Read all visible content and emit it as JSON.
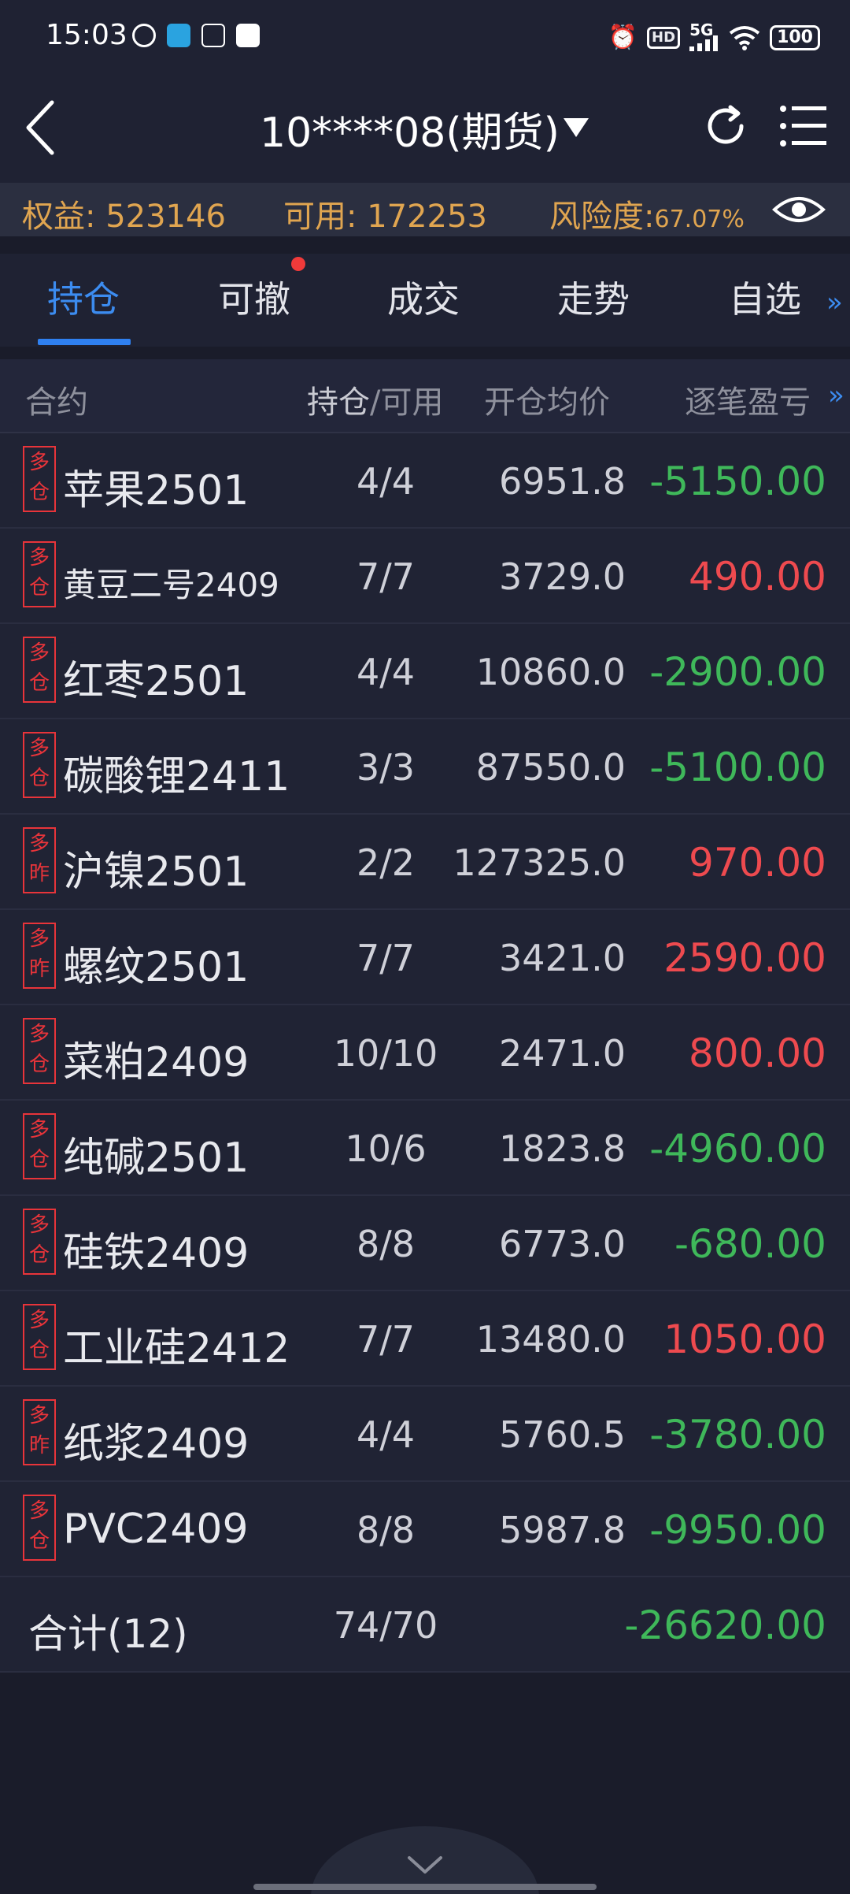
{
  "status_bar": {
    "time": "15:03",
    "network": "5G",
    "hd": "HD",
    "battery": "100"
  },
  "header": {
    "account": "10****08(期货)"
  },
  "account_bar": {
    "equity_label": "权益:",
    "equity_value": "523146",
    "available_label": "可用:",
    "available_value": "172253",
    "risk_label": "风险度:",
    "risk_value": "67.07%"
  },
  "tabs": [
    "持仓",
    "可撤",
    "成交",
    "走势",
    "自选"
  ],
  "table": {
    "headers": {
      "contract": "合约",
      "position": "持仓",
      "available": "/可用",
      "avg_price": "开仓均价",
      "pnl": "逐笔盈亏"
    },
    "rows": [
      {
        "b1": "多",
        "b2": "仓",
        "name": "苹果2501",
        "qty": "4/4",
        "price": "6951.8",
        "pnl": "-5150.00",
        "dir": "neg"
      },
      {
        "b1": "多",
        "b2": "仓",
        "name": "黄豆二号2409",
        "qty": "7/7",
        "price": "3729.0",
        "pnl": "490.00",
        "dir": "pos"
      },
      {
        "b1": "多",
        "b2": "仓",
        "name": "红枣2501",
        "qty": "4/4",
        "price": "10860.0",
        "pnl": "-2900.00",
        "dir": "neg"
      },
      {
        "b1": "多",
        "b2": "仓",
        "name": "碳酸锂2411",
        "qty": "3/3",
        "price": "87550.0",
        "pnl": "-5100.00",
        "dir": "neg"
      },
      {
        "b1": "多",
        "b2": "昨",
        "name": "沪镍2501",
        "qty": "2/2",
        "price": "127325.0",
        "pnl": "970.00",
        "dir": "pos"
      },
      {
        "b1": "多",
        "b2": "昨",
        "name": "螺纹2501",
        "qty": "7/7",
        "price": "3421.0",
        "pnl": "2590.00",
        "dir": "pos"
      },
      {
        "b1": "多",
        "b2": "仓",
        "name": "菜粕2409",
        "qty": "10/10",
        "price": "2471.0",
        "pnl": "800.00",
        "dir": "pos"
      },
      {
        "b1": "多",
        "b2": "仓",
        "name": "纯碱2501",
        "qty": "10/6",
        "price": "1823.8",
        "pnl": "-4960.00",
        "dir": "neg"
      },
      {
        "b1": "多",
        "b2": "仓",
        "name": "硅铁2409",
        "qty": "8/8",
        "price": "6773.0",
        "pnl": "-680.00",
        "dir": "neg"
      },
      {
        "b1": "多",
        "b2": "仓",
        "name": "工业硅2412",
        "qty": "7/7",
        "price": "13480.0",
        "pnl": "1050.00",
        "dir": "pos"
      },
      {
        "b1": "多",
        "b2": "昨",
        "name": "纸浆2409",
        "qty": "4/4",
        "price": "5760.5",
        "pnl": "-3780.00",
        "dir": "neg"
      },
      {
        "b1": "多",
        "b2": "仓",
        "name": "PVC2409",
        "qty": "8/8",
        "price": "5987.8",
        "pnl": "-9950.00",
        "dir": "neg"
      }
    ],
    "total": {
      "label": "合计(12)",
      "qty": "74/70",
      "pnl": "-26620.00",
      "dir": "neg"
    }
  },
  "colors": {
    "profit": "#ee4a4f",
    "loss": "#3fb85a",
    "accent": "#3c8cf0",
    "account_text": "#e0a550",
    "background": "#1a1c2a"
  },
  "icons": {
    "back": "back-chevron-icon",
    "caret": "dropdown-triangle-icon",
    "refresh": "refresh-icon",
    "menu": "menu-list-icon",
    "eye": "eye-icon",
    "expand": "chevron-down-icon"
  }
}
